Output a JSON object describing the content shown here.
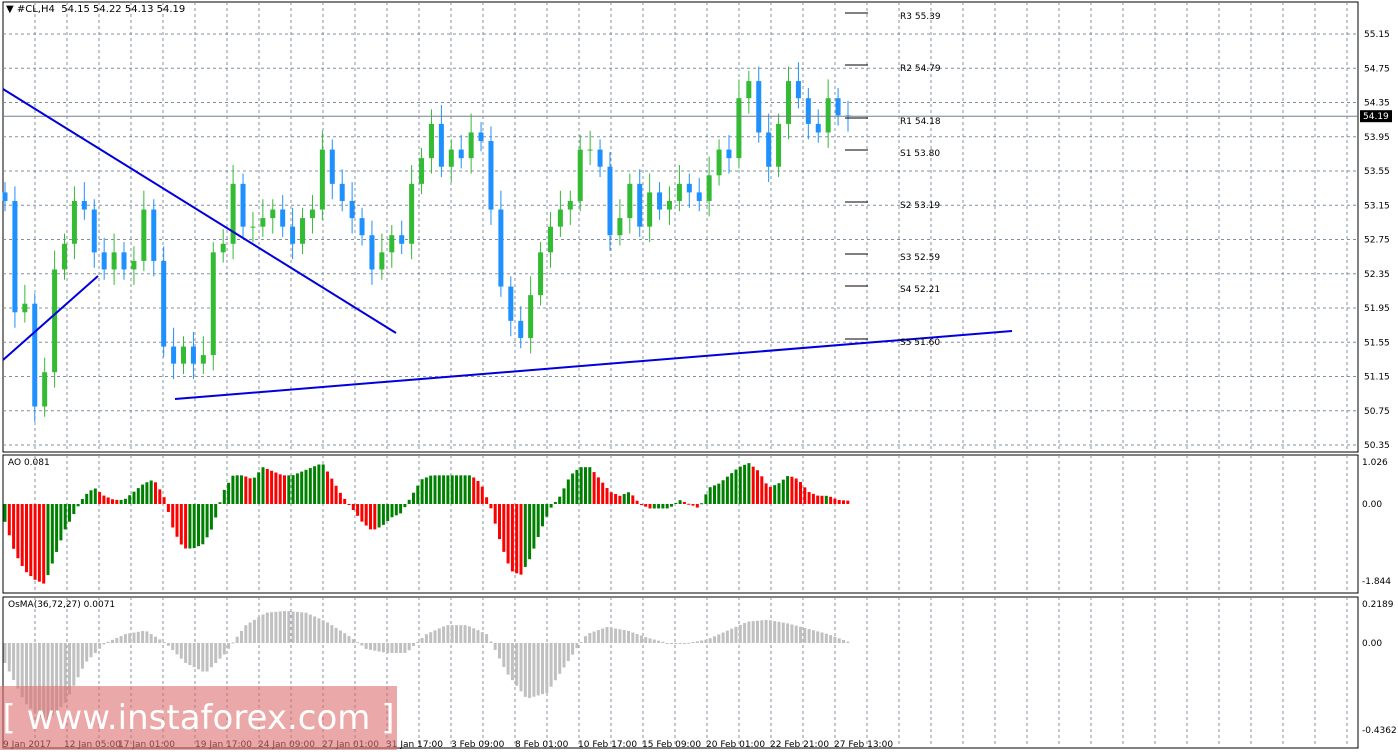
{
  "header": {
    "symbol": "#CL,H4",
    "ohlc": "54.15 54.22 54.13 54.19"
  },
  "watermark": "[ www.instaforex.com ]",
  "chart_data": {
    "type": "candlestick",
    "title": "#CL,H4",
    "current_price": "54.19",
    "price_ticks": [
      "55.15",
      "54.75",
      "54.35",
      "53.95",
      "53.55",
      "53.15",
      "52.75",
      "52.35",
      "51.95",
      "51.55",
      "51.15",
      "50.75",
      "50.35"
    ],
    "time_labels": [
      "9 Jan 2017",
      "12 Jan 05:00",
      "17 Jan 01:00",
      "19 Jan 17:00",
      "24 Jan 09:00",
      "27 Jan 01:00",
      "31 Jan 17:00",
      "3 Feb 09:00",
      "8 Feb 01:00",
      "10 Feb 17:00",
      "15 Feb 09:00",
      "20 Feb 01:00",
      "22 Feb 21:00",
      "27 Feb 13:00"
    ],
    "closes": [
      53.2,
      51.9,
      52.0,
      50.8,
      51.2,
      52.4,
      52.7,
      53.2,
      53.1,
      52.6,
      52.4,
      52.6,
      52.4,
      52.5,
      53.1,
      52.5,
      51.5,
      51.3,
      51.5,
      51.3,
      51.4,
      52.6,
      52.7,
      53.4,
      52.9,
      52.9,
      53.0,
      53.1,
      52.9,
      52.7,
      53.0,
      53.1,
      53.8,
      53.4,
      53.2,
      53.0,
      52.8,
      52.4,
      52.6,
      52.8,
      52.7,
      53.4,
      53.7,
      54.1,
      53.6,
      53.8,
      53.7,
      54.0,
      53.9,
      53.1,
      52.2,
      51.8,
      51.6,
      52.1,
      52.6,
      52.9,
      53.1,
      53.2,
      53.8,
      53.8,
      53.6,
      52.8,
      53.0,
      53.4,
      52.9,
      53.3,
      53.1,
      53.2,
      53.4,
      53.3,
      53.2,
      53.5,
      53.8,
      53.7,
      54.4,
      54.6,
      54.0,
      53.6,
      54.1,
      54.6,
      54.4,
      54.1,
      54.0,
      54.4,
      54.2,
      54.19
    ],
    "pivots": [
      {
        "label": "R3",
        "value": "55.39"
      },
      {
        "label": "R2",
        "value": "54.79"
      },
      {
        "label": "R1",
        "value": "54.18"
      },
      {
        "label": "S1",
        "value": "53.80"
      },
      {
        "label": "S2",
        "value": "53.19"
      },
      {
        "label": "S3",
        "value": "52.59"
      },
      {
        "label": "S4",
        "value": "52.21"
      },
      {
        "label": "S5",
        "value": "51.60"
      }
    ],
    "ao": {
      "label": "AO 0.081",
      "ticks": [
        "1.026",
        "0.00",
        "-1.844"
      ],
      "values": [
        -0.4,
        -1.1,
        -1.5,
        -1.7,
        -1.8,
        -1.2,
        -0.6,
        -0.2,
        0.2,
        0.4,
        0.2,
        0.1,
        0.1,
        0.3,
        0.5,
        0.6,
        0.2,
        -0.6,
        -1.0,
        -1.0,
        -0.9,
        -0.5,
        0.3,
        0.7,
        0.7,
        0.6,
        0.9,
        0.8,
        0.7,
        0.7,
        0.8,
        0.9,
        1.0,
        0.6,
        0.2,
        -0.1,
        -0.4,
        -0.6,
        -0.5,
        -0.3,
        -0.2,
        0.2,
        0.6,
        0.7,
        0.7,
        0.7,
        0.7,
        0.7,
        0.5,
        -0.1,
        -0.9,
        -1.5,
        -1.6,
        -1.2,
        -0.6,
        -0.1,
        0.2,
        0.7,
        0.9,
        0.9,
        0.6,
        0.3,
        0.2,
        0.3,
        0.0,
        -0.1,
        -0.1,
        -0.1,
        0.1,
        0.0,
        -0.1,
        0.4,
        0.5,
        0.7,
        0.9,
        1.0,
        0.8,
        0.4,
        0.5,
        0.7,
        0.6,
        0.3,
        0.2,
        0.2,
        0.1,
        0.081
      ]
    },
    "osma": {
      "label": "OsMA(36,72,27) 0.0071",
      "ticks": [
        "0.2189",
        "0.00",
        "-0.4362"
      ],
      "values": [
        -0.1,
        -0.3,
        -0.4,
        -0.3,
        -0.1,
        0.0,
        0.05,
        0.07,
        0.0,
        -0.1,
        -0.15,
        -0.05,
        0.1,
        0.17,
        0.18,
        0.17,
        0.12,
        0.05,
        -0.03,
        -0.05,
        -0.05,
        0.05,
        0.1,
        0.1,
        0.05,
        -0.15,
        -0.28,
        -0.25,
        -0.1,
        0.05,
        0.09,
        0.07,
        0.03,
        0.0,
        0.0,
        0.02,
        0.07,
        0.12,
        0.13,
        0.11,
        0.08,
        0.05,
        0.0071
      ]
    }
  },
  "colors": {
    "up": "#33bb33",
    "down": "#1e90ff",
    "trend": "#0000dd",
    "ao_up": "#008000",
    "ao_down": "#ff0000",
    "osma": "#c0c0c0"
  }
}
